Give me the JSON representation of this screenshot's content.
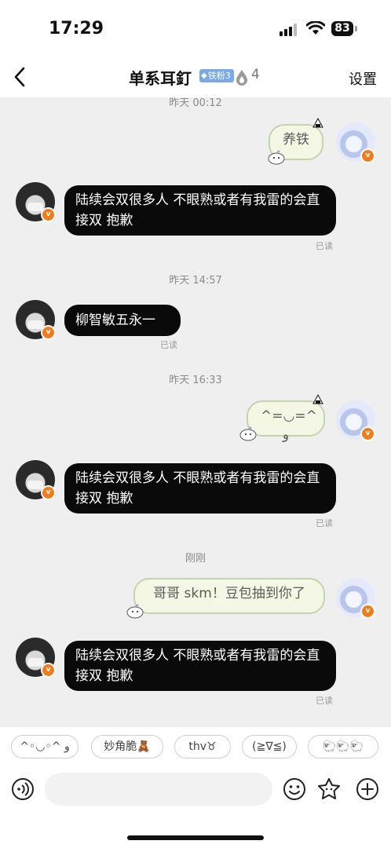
{
  "status_bar": {
    "time": "17:29",
    "battery": "83"
  },
  "header": {
    "title": "单系耳釘",
    "fan_badge": "铁粉3",
    "fire_count": "4",
    "settings_label": "设置"
  },
  "chat": {
    "top_timestamp": "昨天 00:12",
    "msg1": "养铁",
    "msg2": "陆续会双很多人 不眼熟或者有我雷的会直接双 抱歉",
    "read2": "已读",
    "ts2": "昨天 14:57",
    "msg3": "柳智敏五永一",
    "read3": "已读",
    "ts3": "昨天 16:33",
    "msg4": "^=◡=^ ﻭ",
    "msg5": "陆续会双很多人 不眼熟或者有我雷的会直接双 抱歉",
    "read5": "已读",
    "ts4": "刚刚",
    "msg6": "哥哥 skm！豆包抽到你了",
    "msg7": "陆续会双很多人 不眼熟或者有我雷的会直接双 抱歉",
    "read7": "已读"
  },
  "quick_replies": [
    "^◦◡◦^ ﻭ",
    "妙角脆🧸",
    "thv♉︎",
    "(≧∇≦)",
    "🐑🐑🐑"
  ],
  "input_placeholder": "",
  "colors": {
    "accent_badge": "#7aa9e8",
    "vip": "#f07d1d",
    "bubble_dark": "#0a0a0a",
    "bubble_light": "#f3f7e4"
  }
}
